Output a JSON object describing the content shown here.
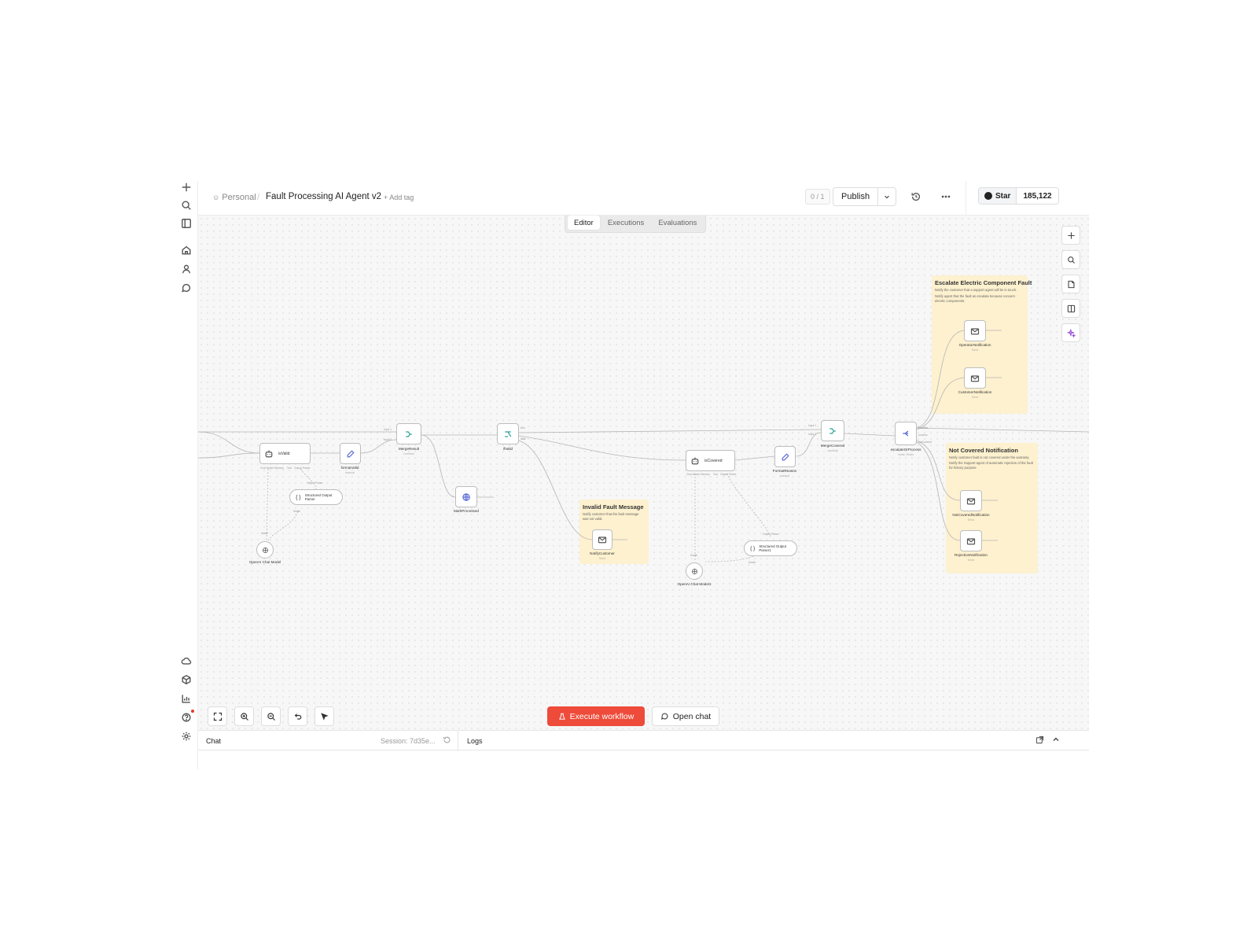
{
  "breadcrumb": {
    "project": "Personal",
    "workflow_name": "Fault Processing AI Agent v2",
    "add_tag": "+ Add tag"
  },
  "header": {
    "counter": "0 / 1",
    "publish": "Publish",
    "github_star": "Star",
    "github_count": "185,122"
  },
  "tabs": [
    "Editor",
    "Executions",
    "Evaluations"
  ],
  "nodes": {
    "isValid": "isValid",
    "formatValid": "formatValid",
    "formatValid_sub": "manual",
    "mergeResult": "MergeResult",
    "mergeResult_sub": "combine",
    "ifValid": "ifValid",
    "markProcessed": "MarkProcessed",
    "structuredParser": "Structured Output Parser",
    "openaiModel": "OpenAI Chat Model",
    "notifyCustomer": "NotifyCustomer",
    "notifyCustomer_sub": "Send",
    "isCovered": "isCovered",
    "formatReason": "FormatReason",
    "formatReason_sub": "manual",
    "structuredParser1": "Structured Output Parser1",
    "openaiModel1": "OpenAI Chat Model1",
    "mergeCovered": "MergeCovered",
    "mergeCovered_sub": "combine",
    "escalateOrProcess": "escalateOrProcess",
    "escalateOrProcess_sub": "mode: Rules",
    "operatorNotification": "OperatorNotification",
    "customerNotification": "CustomerNotification",
    "notCoveredNotification": "NotCoveredNotification",
    "rejectionNotification": "RejectionNotification",
    "send_sub": "Send"
  },
  "port_labels": {
    "chat_model": "Chat Model",
    "memory": "Memory",
    "tool": "Tool",
    "output_parser": "Output Parser",
    "model": "Model",
    "input1": "Input 1",
    "input2": "Input 2",
    "true": "true",
    "false": "false",
    "escalate": "escalate",
    "process": "process",
    "notcovered": "notCovered"
  },
  "notes": {
    "invalid": {
      "title": "Invalid Fault Message",
      "body": "Notify customer that the fault message was not valid."
    },
    "escalate": {
      "title": "Escalate Electric Component Fault",
      "body1": "Notify the customer that a support agent will be in touch.",
      "body2": "Notify agent that the fault as escalate because concern electric components."
    },
    "notcovered": {
      "title": "Not Covered Notification",
      "body1": "Notify customer fault is not covered under the warranty.",
      "body2": "Notify the Support agent of automatic rejection of the fault for history purpose"
    }
  },
  "toolbar": {
    "execute": "Execute workflow",
    "open_chat": "Open chat"
  },
  "footer": {
    "chat": "Chat",
    "session": "Session: 7d35e...",
    "logs": "Logs"
  },
  "colors": {
    "accent": "#ee4b3a",
    "note": "#fdf1cf",
    "node_icon_teal": "#2aa198",
    "node_icon_blue": "#5b6bd6",
    "node_icon_purple": "#9b59d9"
  }
}
